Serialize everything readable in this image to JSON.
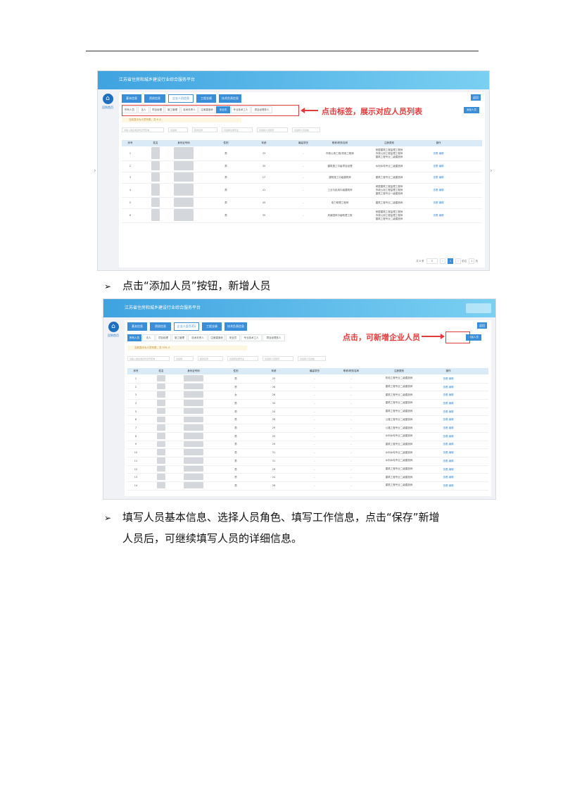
{
  "screenshot1": {
    "platform_title": "江苏省住房和城乡建设行业综合服务平台",
    "home_label": "回到首页",
    "main_tabs": [
      "基本信息",
      "资质信息",
      "企业人员信息",
      "工程业绩",
      "技术负责信息"
    ],
    "back_label": "返回",
    "sub_tabs": [
      "所有人员",
      "法人",
      "项目经理",
      "施工管理",
      "技术负责人",
      "注册建造师",
      "安全员",
      "专业技术工人",
      "项目经理多人"
    ],
    "add_label": "添加人员",
    "notice": "当前显示为人员列表，共 6 人",
    "filter_placeholders": [
      "请输入姓名或身份证号查询",
      "请选择",
      "职务名称",
      "请选择注册专业",
      "请选择人员职称",
      "请选择人员资格"
    ],
    "annotation": "点击标签，展示对应人员列表",
    "columns": [
      "序号",
      "姓名",
      "身份证号码",
      "性别",
      "年龄",
      "最高学历",
      "职称/职务名称",
      "注册类别",
      "操作"
    ],
    "rows": [
      {
        "no": "1",
        "gender": "男",
        "age": "33",
        "edu": "-",
        "title": "市政公用工程/机电工程师",
        "reg": [
          "房屋建筑工程监理工程师",
          "市政公用工程监理工程师",
          "建筑工程专业二级建造师"
        ],
        "op": "查看 编辑"
      },
      {
        "no": "2",
        "gender": "男",
        "age": "35",
        "edu": "-",
        "title": "建筑施工中级项目经理",
        "reg": [
          "水利水电专业二级建造师"
        ],
        "op": "查看 编辑"
      },
      {
        "no": "3",
        "gender": "男",
        "age": "27",
        "edu": "-",
        "title": "建筑施工中级建筑师",
        "reg": [
          "建筑工程专业二级建造师"
        ],
        "op": "查看 编辑"
      },
      {
        "no": "4",
        "gender": "男",
        "age": "41",
        "edu": "-",
        "title": "工业与民用中级建筑师",
        "reg": [
          "房屋建筑工程监理工程师",
          "市政公用工程监理工程师",
          "建筑工程专业一级建造师"
        ],
        "op": "查看 编辑"
      },
      {
        "no": "5",
        "gender": "男",
        "age": "45",
        "edu": "-",
        "title": "电力助理工程师",
        "reg": [
          "建筑工程专业二级建造师"
        ],
        "op": "查看 编辑"
      },
      {
        "no": "6",
        "gender": "男",
        "age": "35",
        "edu": "-",
        "title": "风景园林中级助理工程",
        "reg": [
          "房屋建筑工程监理工程师",
          "市政公用工程监理工程师",
          "建筑工程专业二级建造师"
        ],
        "op": "查看 编辑"
      }
    ],
    "pager": {
      "total": "共 6 条",
      "size": "5",
      "current": "1",
      "jump": "前往",
      "page": "1",
      "unit": "页"
    }
  },
  "bullet1": "点击“添加人员”按钮，新增人员",
  "screenshot2": {
    "platform_title": "江苏省住房和城乡建设行业综合服务平台",
    "home_label": "回到首页",
    "main_tabs": [
      "基本信息",
      "资质信息",
      "企业人员(535)",
      "工程业绩",
      "技术负责信息"
    ],
    "back_label": "返回",
    "sub_tabs": [
      "所有人员",
      "法人",
      "项目经理",
      "施工管理",
      "技术负责人",
      "注册建造师",
      "安全员",
      "专业技术工人",
      "项目经理多人"
    ],
    "add_label": "添加人员",
    "notice": "当前显示为人员列表，共 535 人",
    "filter_placeholders": [
      "请输入姓名或身份证号查询",
      "请选择",
      "职务名称",
      "请选择注册专业",
      "请选择人员职称",
      "请选择人员资格"
    ],
    "annotation": "点击，可新增企业人员",
    "columns": [
      "序号",
      "姓名",
      "身份证号码",
      "性别",
      "年龄",
      "最高学历",
      "职称/职务名称",
      "注册类别",
      "操作"
    ],
    "rows": [
      {
        "no": "1",
        "gender": "男",
        "age": "25",
        "edu": "-",
        "title": "-",
        "reg": "机电工程专业二级建造师",
        "op": "查看 编辑"
      },
      {
        "no": "2",
        "gender": "男",
        "age": "26",
        "edu": "-",
        "title": "-",
        "reg": "建筑工程专业二级建造师",
        "op": "查看 编辑"
      },
      {
        "no": "3",
        "gender": "女",
        "age": "26",
        "edu": "-",
        "title": "-",
        "reg": "建筑工程专业二级建造师",
        "op": "查看 编辑"
      },
      {
        "no": "4",
        "gender": "男",
        "age": "34",
        "edu": "-",
        "title": "-",
        "reg": "建筑工程专业二级建造师",
        "op": "查看 编辑"
      },
      {
        "no": "5",
        "gender": "男",
        "age": "24",
        "edu": "-",
        "title": "-",
        "reg": "建筑工程专业二级建造师",
        "op": "查看 编辑"
      },
      {
        "no": "6",
        "gender": "男",
        "age": "26",
        "edu": "-",
        "title": "-",
        "reg": "公路工程专业二级建造师",
        "op": "查看 编辑"
      },
      {
        "no": "7",
        "gender": "男",
        "age": "29",
        "edu": "-",
        "title": "-",
        "reg": "公路工程专业二级建造师",
        "op": "查看 编辑"
      },
      {
        "no": "8",
        "gender": "男",
        "age": "29",
        "edu": "-",
        "title": "-",
        "reg": "水利水电专业二级建造师",
        "op": "查看 编辑"
      },
      {
        "no": "9",
        "gender": "男",
        "age": "29",
        "edu": "-",
        "title": "-",
        "reg": "建筑工程专业二级建造师",
        "op": "查看 编辑"
      },
      {
        "no": "10",
        "gender": "男",
        "age": "31",
        "edu": "-",
        "title": "-",
        "reg": "水利水电专业二级建造师",
        "op": "查看 编辑"
      },
      {
        "no": "11",
        "gender": "男",
        "age": "31",
        "edu": "-",
        "title": "-",
        "reg": "水利水电专业二级建造师",
        "op": "查看 编辑"
      },
      {
        "no": "12",
        "gender": "男",
        "age": "29",
        "edu": "-",
        "title": "-",
        "reg": "建筑工程专业二级建造师",
        "op": "查看 编辑"
      },
      {
        "no": "13",
        "gender": "男",
        "age": "24",
        "edu": "-",
        "title": "-",
        "reg": "建筑工程专业二级建造师",
        "op": "查看 编辑"
      },
      {
        "no": "14",
        "gender": "男",
        "age": "28",
        "edu": "-",
        "title": "-",
        "reg": "建筑工程专业二级建造师",
        "op": "查看 编辑"
      }
    ]
  },
  "bullet2_line1": "填写人员基本信息、选择人员角色、填写工作信息，点击“保存”新增",
  "bullet2_line2": "人员后，可继续填写人员的详细信息。",
  "bullet_mark": "➢"
}
